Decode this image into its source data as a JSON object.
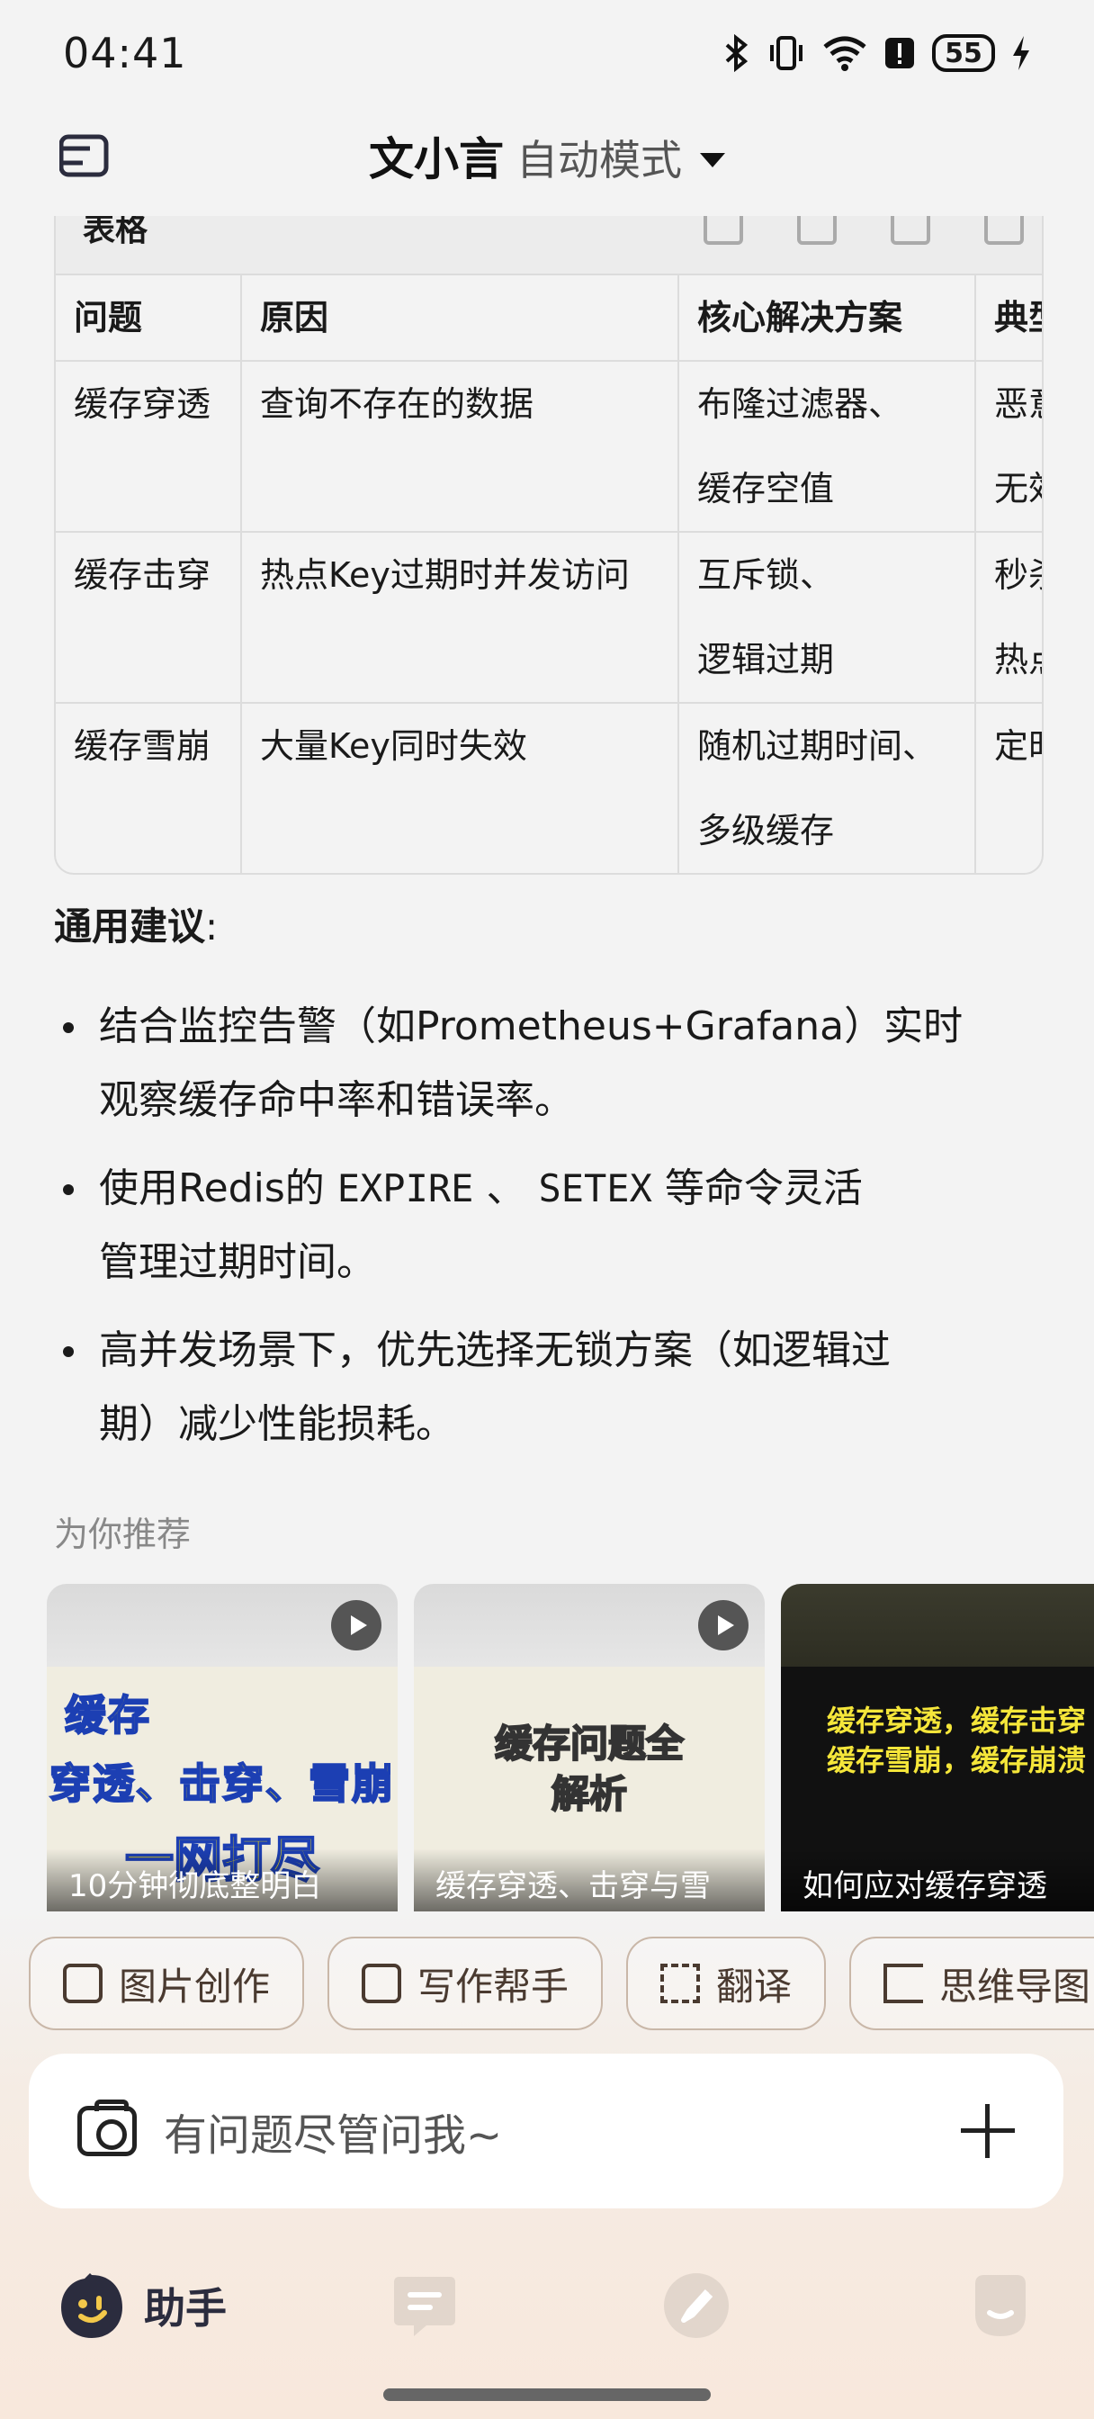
{
  "status_bar": {
    "time": "04:41",
    "battery": "55",
    "icons": [
      "bluetooth-icon",
      "vibrate-icon",
      "wifi-icon",
      "alert-icon",
      "battery-icon",
      "charging-icon"
    ]
  },
  "header": {
    "app_name": "文小言",
    "mode": "自动模式"
  },
  "table": {
    "toolbar_title": "表格",
    "headers": [
      "问题",
      "原因",
      "核心解决方案",
      "典型"
    ],
    "rows": [
      {
        "problem": "缓存穿透",
        "cause": "查询不存在的数据",
        "solution_1": "布隆过滤器、",
        "solution_2": "缓存空值",
        "typical_1": "恶意",
        "typical_2": "无效"
      },
      {
        "problem": "缓存击穿",
        "cause": "热点Key过期时并发访问",
        "solution_1": "互斥锁、",
        "solution_2": "逻辑过期",
        "typical_1": "秒杀",
        "typical_2": "热点"
      },
      {
        "problem": "缓存雪崩",
        "cause": "大量Key同时失效",
        "solution_1": "随机过期时间、",
        "solution_2": "多级缓存",
        "typical_1": "定时",
        "typical_2": ""
      }
    ]
  },
  "suggestions": {
    "title": "通用建议",
    "colon": ":",
    "items": [
      {
        "line1": "结合监控告警（如Prometheus+Grafana）实时",
        "line2": "观察缓存命中率和错误率。"
      },
      {
        "pre": "使用Redis的 ",
        "code1": "EXPIRE",
        "mid": " 、 ",
        "code2": "SETEX",
        "post": " 等命令灵活",
        "line2": "管理过期时间。"
      },
      {
        "line1": "高并发场景下，优先选择无锁方案（如逻辑过",
        "line2": "期）减少性能损耗。"
      }
    ]
  },
  "recommend": {
    "title": "为你推荐",
    "cards": [
      {
        "caption": "10分钟彻底整明白",
        "thumb_line1": "缓存",
        "thumb_line2": "穿透、击穿、雪崩",
        "thumb_line3": "一网打尽"
      },
      {
        "caption": "缓存穿透、击穿与雪",
        "thumb_line1": "缓存问题全",
        "thumb_line2": "解析"
      },
      {
        "caption": "如何应对缓存穿透",
        "thumb_line1": "缓存穿透，缓存击穿",
        "thumb_line2": "缓存雪崩，缓存崩溃"
      }
    ]
  },
  "chips": [
    {
      "label": "图片创作",
      "icon": "image-icon"
    },
    {
      "label": "写作帮手",
      "icon": "edit-icon"
    },
    {
      "label": "翻译",
      "icon": "translate-icon"
    },
    {
      "label": "思维导图",
      "icon": "mindmap-icon"
    }
  ],
  "input": {
    "placeholder": "有问题尽管问我~"
  },
  "nav": {
    "assistant_label": "助手"
  }
}
